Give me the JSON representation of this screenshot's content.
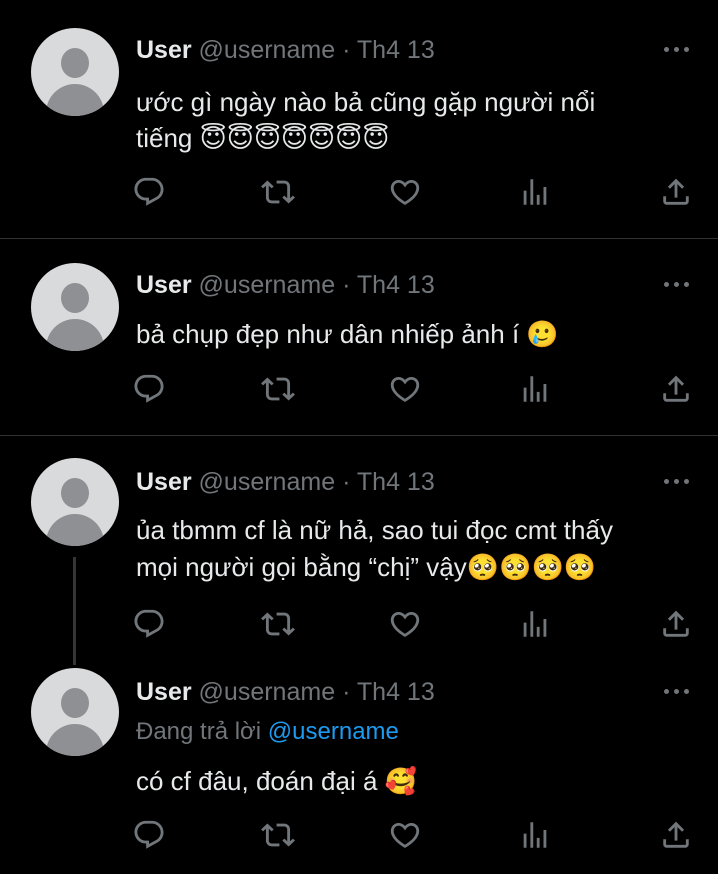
{
  "tweets": [
    {
      "name": "User",
      "handle": "@username",
      "dot": "·",
      "date": "Th4 13",
      "text": [
        "ước gì ngày nào bả cũng gặp người nổi",
        "tiếng 😇😇😇😇😇😇😇"
      ]
    },
    {
      "name": "User",
      "handle": "@username",
      "dot": "·",
      "date": "Th4 13",
      "text": [
        "bả chụp đẹp như dân nhiếp ảnh í 🥲"
      ]
    },
    {
      "name": "User",
      "handle": "@username",
      "dot": "·",
      "date": "Th4 13",
      "text": [
        "ủa tbmm cf là nữ hả, sao tui đọc cmt thấy",
        "mọi người gọi bằng “chị” vậy🥺🥺🥺🥺"
      ]
    },
    {
      "name": "User",
      "handle": "@username",
      "dot": "·",
      "date": "Th4 13",
      "reply_prefix": "Đang trả lời",
      "reply_mention": "@username",
      "text": [
        "có cf đâu, đoán đại á 🥰"
      ]
    }
  ],
  "icons": {
    "reply": "reply-icon",
    "retweet": "retweet-icon",
    "like": "heart-icon",
    "views": "views-icon",
    "share": "share-icon",
    "more": "more-icon"
  },
  "colors": {
    "background": "#000000",
    "text": "#e7e9ea",
    "muted": "#71767b",
    "link": "#1d9bf0"
  }
}
